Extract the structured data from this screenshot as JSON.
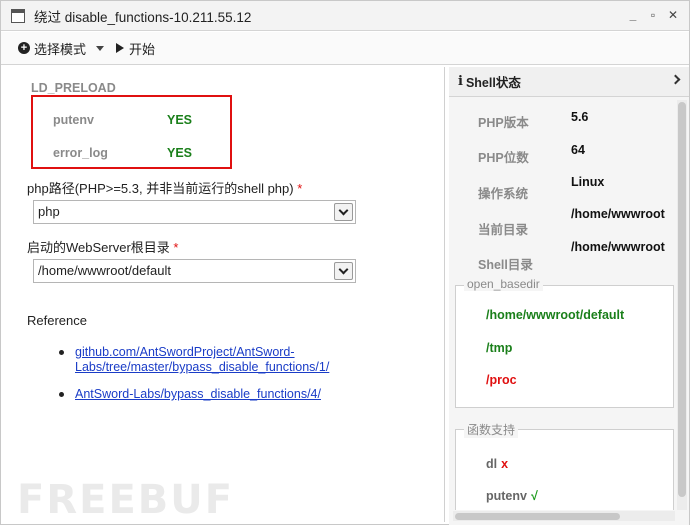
{
  "window": {
    "title": "绕过 disable_functions-10.211.55.12"
  },
  "toolbar": {
    "select_mode_label": "选择模式",
    "start_label": "开始"
  },
  "left": {
    "section_title": "LD_PRELOAD",
    "status": [
      {
        "name": "putenv",
        "value": "YES"
      },
      {
        "name": "error_log",
        "value": "YES"
      }
    ],
    "php_path": {
      "label": "php路径(PHP>=5.3, 并非当前运行的shell php)",
      "required": "*",
      "value": "php"
    },
    "webroot": {
      "label": "启动的WebServer根目录",
      "required": "*",
      "value": "/home/wwwroot/default"
    },
    "reference": {
      "title": "Reference",
      "links": [
        {
          "line1": "github.com/AntSwordProject/AntSword-",
          "line2": "Labs/tree/master/bypass_disable_functions/1/"
        },
        {
          "line1": "AntSword-Labs/bypass_disable_functions/4/"
        }
      ]
    }
  },
  "right": {
    "header": "Shell状态",
    "info": [
      {
        "label": "PHP版本",
        "value": "5.6"
      },
      {
        "label": "PHP位数",
        "value": "64"
      },
      {
        "label": "操作系统",
        "value": "Linux"
      },
      {
        "label": "当前目录",
        "value": "/home/wwwroot"
      },
      {
        "label": "Shell目录",
        "value": "/home/wwwroot"
      }
    ],
    "open_basedir": {
      "legend": "open_basedir",
      "green": [
        "/home/wwwroot/default",
        "/tmp"
      ],
      "red": [
        "/proc"
      ]
    },
    "functions": {
      "legend": "函数支持",
      "items": [
        {
          "name": "dl",
          "mark": "x"
        },
        {
          "name": "putenv",
          "mark": "√"
        }
      ]
    }
  },
  "watermark": "FREEBUF"
}
